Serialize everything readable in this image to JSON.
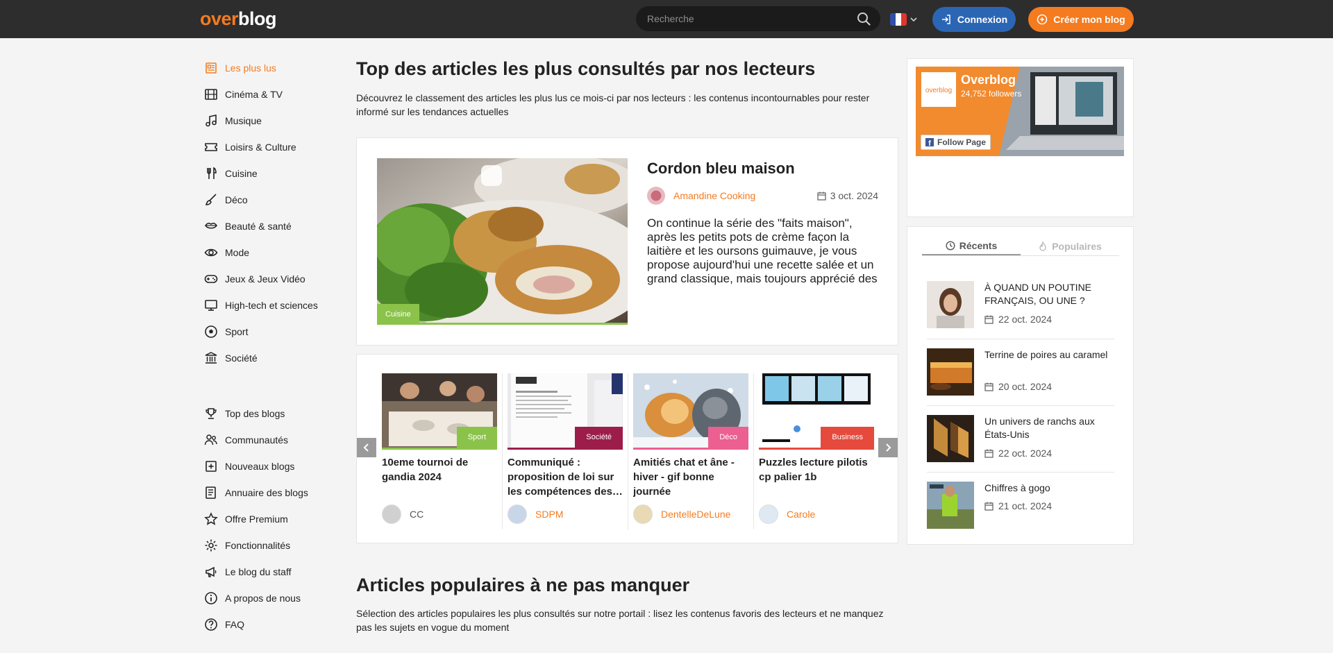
{
  "header": {
    "logo_part1": "over",
    "logo_part2": "blog",
    "search_placeholder": "Recherche",
    "login_label": "Connexion",
    "create_label": "Créer mon blog",
    "brand_color": "#f47b20",
    "login_color": "#2b66b5"
  },
  "sidebar": {
    "categories": [
      {
        "label": "Les plus lus",
        "icon": "newspaper-icon",
        "active": true
      },
      {
        "label": "Cinéma & TV",
        "icon": "film-icon"
      },
      {
        "label": "Musique",
        "icon": "music-icon"
      },
      {
        "label": "Loisirs & Culture",
        "icon": "ticket-icon"
      },
      {
        "label": "Cuisine",
        "icon": "utensils-icon"
      },
      {
        "label": "Déco",
        "icon": "paintbrush-icon"
      },
      {
        "label": "Beauté & santé",
        "icon": "lips-icon"
      },
      {
        "label": "Mode",
        "icon": "eye-icon"
      },
      {
        "label": "Jeux & Jeux Vidéo",
        "icon": "gamepad-icon"
      },
      {
        "label": "High-tech et sciences",
        "icon": "monitor-icon"
      },
      {
        "label": "Sport",
        "icon": "football-icon"
      },
      {
        "label": "Société",
        "icon": "institution-icon"
      }
    ],
    "links": [
      {
        "label": "Top des blogs",
        "icon": "trophy-icon"
      },
      {
        "label": "Communautés",
        "icon": "users-icon"
      },
      {
        "label": "Nouveaux blogs",
        "icon": "plus-square-icon"
      },
      {
        "label": "Annuaire des blogs",
        "icon": "directory-icon"
      },
      {
        "label": "Offre Premium",
        "icon": "star-icon"
      },
      {
        "label": "Fonctionnalités",
        "icon": "gear-icon"
      },
      {
        "label": "Le blog du staff",
        "icon": "megaphone-icon"
      },
      {
        "label": "A propos de nous",
        "icon": "info-icon"
      },
      {
        "label": "FAQ",
        "icon": "question-icon"
      }
    ]
  },
  "main": {
    "title": "Top des articles les plus consultés par nos lecteurs",
    "lead": "Découvrez le classement des articles les plus lus ce mois-ci par nos lecteurs : les contenus incontournables pour rester informé sur les tendances actuelles",
    "featured": {
      "category": "Cuisine",
      "category_color": "#8bc34a",
      "title": "Cordon bleu maison",
      "author": "Amandine Cooking",
      "date": "3 oct. 2024",
      "excerpt": "On continue la série des \"faits maison\", après les petits pots de crème façon la laitière et les oursons guimauve, je vous propose aujourd'hui une recette salée et un grand classique, mais toujours apprécié des"
    },
    "carousel": [
      {
        "category": "Sport",
        "color": "#8bc34a",
        "title": "10eme tournoi de gandia 2024",
        "author": "CC",
        "author_color": "#555555"
      },
      {
        "category": "Société",
        "color": "#9c1d4a",
        "title": "Communiqué : proposition de loi sur les compétences des…",
        "author": "SDPM",
        "author_color": "#f47b20"
      },
      {
        "category": "Déco",
        "color": "#ec5f91",
        "title": "Amitiés chat et âne - hiver - gif bonne journée",
        "author": "DentelleDeLune",
        "author_color": "#f47b20"
      },
      {
        "category": "Business",
        "color": "#e54a3c",
        "title": "Puzzles lecture pilotis cp palier 1b",
        "author": "Carole",
        "author_color": "#f47b20"
      }
    ],
    "title2": "Articles populaires à ne pas manquer",
    "lead2": "Sélection des articles populaires les plus consultés sur notre portail : lisez les contenus favoris des lecteurs et ne manquez pas les sujets en vogue du moment"
  },
  "right": {
    "fb": {
      "name": "Overblog",
      "followers": "24,752 followers",
      "follow_label": "Follow Page"
    },
    "tabs": {
      "recent": "Récents",
      "popular": "Populaires"
    },
    "items": [
      {
        "title": "À QUAND UN POUTINE FRANÇAIS, OU UNE ?",
        "date": "22 oct. 2024"
      },
      {
        "title": "Terrine de poires au caramel",
        "date": "20 oct. 2024"
      },
      {
        "title": "Un univers de ranchs aux États-Unis",
        "date": "22 oct. 2024"
      },
      {
        "title": "Chiffres à gogo",
        "date": "21 oct. 2024"
      }
    ]
  }
}
